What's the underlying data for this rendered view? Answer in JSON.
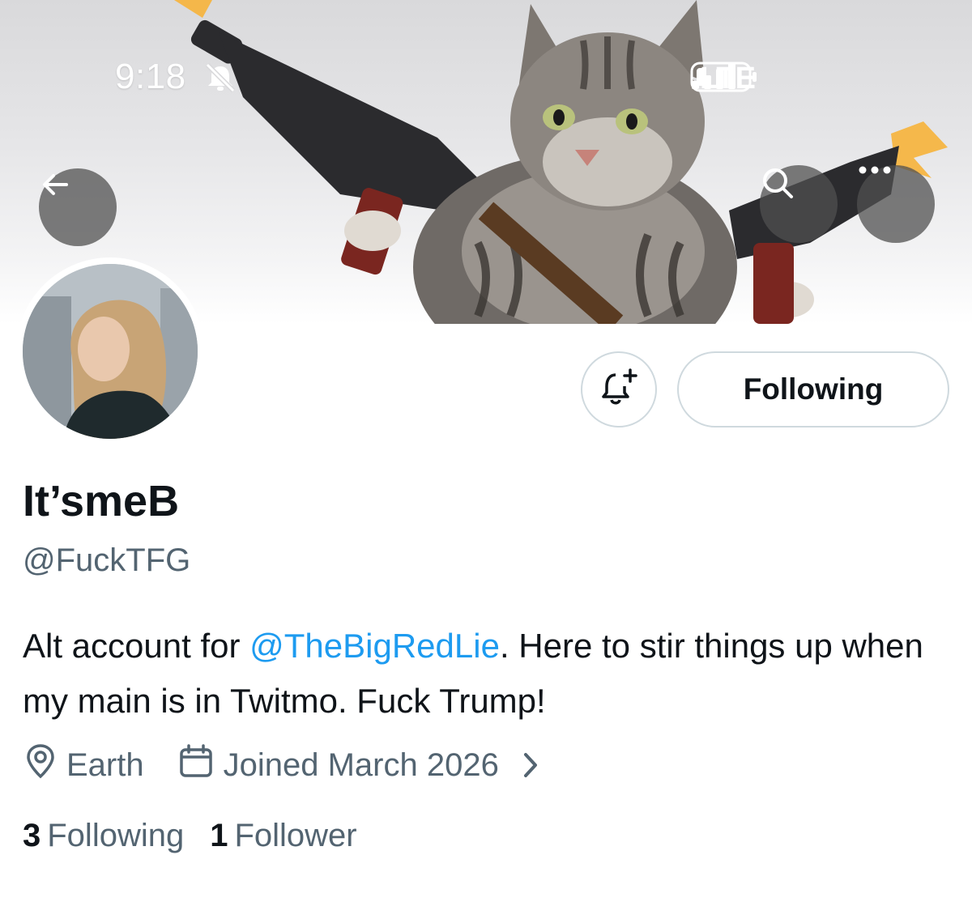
{
  "status_bar": {
    "time": "9:18",
    "network": "LTE"
  },
  "profile": {
    "display_name": "It’smeB",
    "handle": "@FuckTFG",
    "bio_prefix": "Alt account for ",
    "bio_mention": "@TheBigRedLie",
    "bio_suffix": ". Here to stir things up when my main is in Twitmo. Fuck Trump!",
    "location": "Earth",
    "joined": "Joined March 2026",
    "following_count": "3",
    "following_label": "Following",
    "followers_count": "1",
    "followers_label": "Follower"
  },
  "actions": {
    "follow_state_label": "Following"
  },
  "icons": {
    "back": "arrow-left-icon",
    "search": "search-icon",
    "more": "more-icon",
    "notify": "bell-plus-icon",
    "location": "location-pin-icon",
    "calendar": "calendar-icon",
    "mute": "bell-slash-icon",
    "signal": "signal-icon",
    "battery": "battery-icon"
  },
  "colors": {
    "link": "#1d9bf0",
    "secondary_text": "#536471",
    "primary_text": "#0f1419",
    "border": "#cfd9de"
  }
}
